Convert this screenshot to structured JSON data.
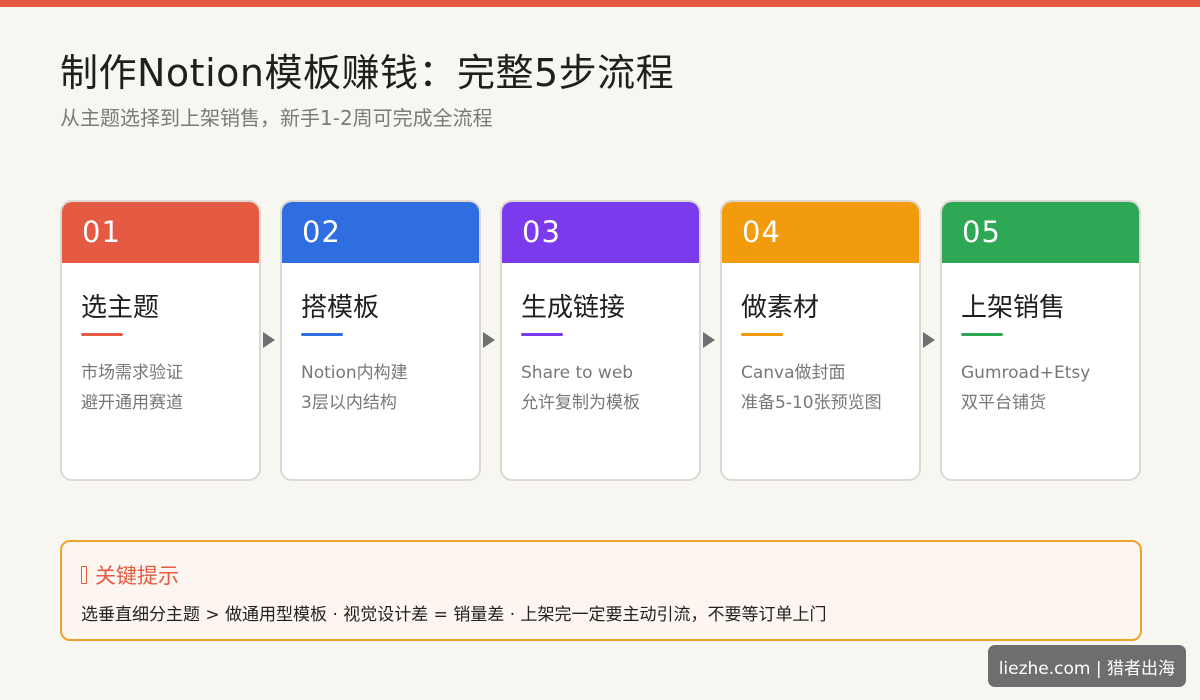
{
  "header": {
    "title": "制作Notion模板赚钱：完整5步流程",
    "subtitle": "从主题选择到上架销售，新手1-2周可完成全流程"
  },
  "colors": {
    "step1": "#e55a43",
    "step2": "#2f6ee0",
    "step3": "#7b3aeb",
    "step4": "#f29b0c",
    "step5": "#2fa855",
    "tip_border": "#f0a12a",
    "tip_title": "#e55a43"
  },
  "steps": [
    {
      "num": "01",
      "title": "选主题",
      "line1": "市场需求验证",
      "line2": "避开通用赛道"
    },
    {
      "num": "02",
      "title": "搭模板",
      "line1": "Notion内构建",
      "line2": "3层以内结构"
    },
    {
      "num": "03",
      "title": "生成链接",
      "line1": "Share to web",
      "line2": "允许复制为模板"
    },
    {
      "num": "04",
      "title": "做素材",
      "line1": "Canva做封面",
      "line2": "准备5-10张预览图"
    },
    {
      "num": "05",
      "title": "上架销售",
      "line1": "Gumroad+Etsy",
      "line2": "双平台铺货"
    }
  ],
  "tip": {
    "icon": "tip-icon",
    "title": "关键提示",
    "body": "选垂直细分主题 > 做通用型模板 · 视觉设计差 = 销量差 · 上架完一定要主动引流，不要等订单上门"
  },
  "watermark": "liezhe.com | 猎者出海"
}
